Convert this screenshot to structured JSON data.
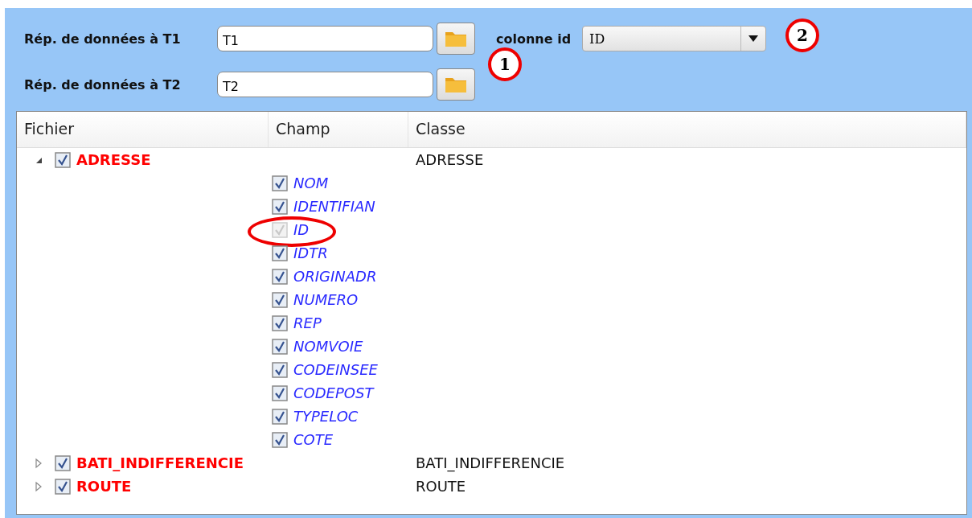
{
  "folders": [
    {
      "label": "Rép. de données à T1",
      "value": "T1"
    },
    {
      "label": "Rép. de données à T2",
      "value": "T2"
    }
  ],
  "id_column": {
    "label": "colonne id",
    "value": "ID"
  },
  "callouts": [
    {
      "text": "1"
    },
    {
      "text": "2"
    }
  ],
  "table": {
    "columns": [
      "Fichier",
      "Champ",
      "Classe"
    ],
    "rows": [
      {
        "name": "ADRESSE",
        "class": "ADRESSE",
        "checked": true,
        "expanded": true,
        "children": [
          {
            "name": "NOM",
            "checked": true,
            "disabled": false,
            "circled": false
          },
          {
            "name": "IDENTIFIAN",
            "checked": true,
            "disabled": false,
            "circled": false
          },
          {
            "name": "ID",
            "checked": true,
            "disabled": true,
            "circled": true
          },
          {
            "name": "IDTR",
            "checked": true,
            "disabled": false,
            "circled": false
          },
          {
            "name": "ORIGINADR",
            "checked": true,
            "disabled": false,
            "circled": false
          },
          {
            "name": "NUMERO",
            "checked": true,
            "disabled": false,
            "circled": false
          },
          {
            "name": "REP",
            "checked": true,
            "disabled": false,
            "circled": false
          },
          {
            "name": "NOMVOIE",
            "checked": true,
            "disabled": false,
            "circled": false
          },
          {
            "name": "CODEINSEE",
            "checked": true,
            "disabled": false,
            "circled": false
          },
          {
            "name": "CODEPOST",
            "checked": true,
            "disabled": false,
            "circled": false
          },
          {
            "name": "TYPELOC",
            "checked": true,
            "disabled": false,
            "circled": false
          },
          {
            "name": "COTE",
            "checked": true,
            "disabled": false,
            "circled": false
          }
        ]
      },
      {
        "name": "BATI_INDIFFERENCIE",
        "class": "BATI_INDIFFERENCIE",
        "checked": true,
        "expanded": false,
        "children": []
      },
      {
        "name": "ROUTE",
        "class": "ROUTE",
        "checked": true,
        "expanded": false,
        "children": []
      }
    ]
  }
}
